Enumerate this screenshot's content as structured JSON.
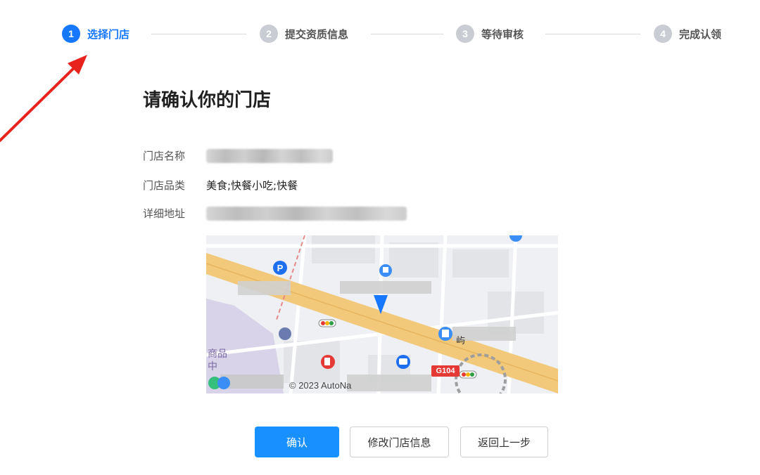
{
  "steps": [
    {
      "num": "1",
      "label": "选择门店",
      "active": true
    },
    {
      "num": "2",
      "label": "提交资质信息",
      "active": false
    },
    {
      "num": "3",
      "label": "等待审核",
      "active": false
    },
    {
      "num": "4",
      "label": "完成认领",
      "active": false
    }
  ],
  "title": "请确认你的门店",
  "store": {
    "name_label": "门店名称",
    "category_label": "门店品类",
    "category_value": "美食;快餐小吃;快餐",
    "address_label": "详细地址"
  },
  "map": {
    "copyright": "© 2023 AutoNa",
    "road_shield": "G104",
    "label_left": "商品中",
    "label_right": "屿"
  },
  "buttons": {
    "confirm": "确认",
    "edit": "修改门店信息",
    "back": "返回上一步"
  },
  "colors": {
    "primary": "#1677ff",
    "annotation": "#e8231d",
    "road": "#f2c97a"
  }
}
